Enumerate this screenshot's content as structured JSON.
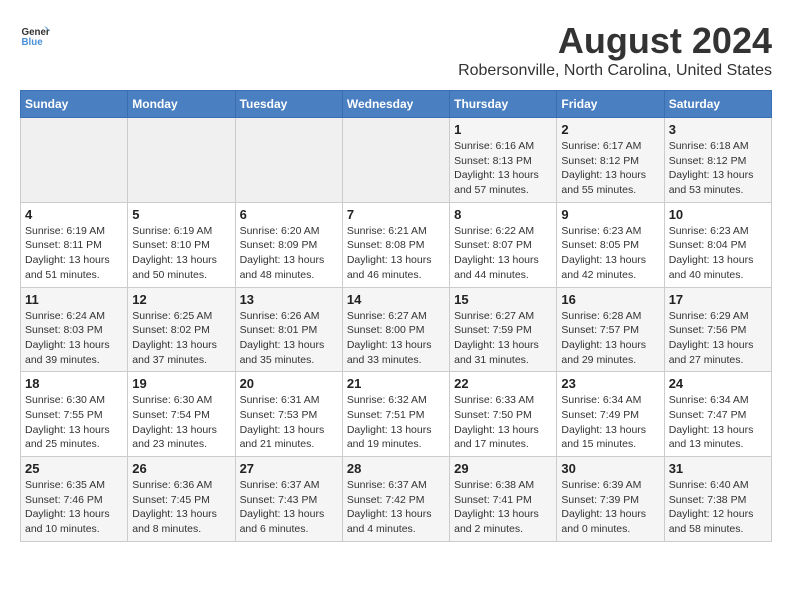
{
  "header": {
    "logo_line1": "General",
    "logo_line2": "Blue",
    "title": "August 2024",
    "subtitle": "Robersonville, North Carolina, United States"
  },
  "weekdays": [
    "Sunday",
    "Monday",
    "Tuesday",
    "Wednesday",
    "Thursday",
    "Friday",
    "Saturday"
  ],
  "weeks": [
    [
      {
        "day": "",
        "info": ""
      },
      {
        "day": "",
        "info": ""
      },
      {
        "day": "",
        "info": ""
      },
      {
        "day": "",
        "info": ""
      },
      {
        "day": "1",
        "info": "Sunrise: 6:16 AM\nSunset: 8:13 PM\nDaylight: 13 hours\nand 57 minutes."
      },
      {
        "day": "2",
        "info": "Sunrise: 6:17 AM\nSunset: 8:12 PM\nDaylight: 13 hours\nand 55 minutes."
      },
      {
        "day": "3",
        "info": "Sunrise: 6:18 AM\nSunset: 8:12 PM\nDaylight: 13 hours\nand 53 minutes."
      }
    ],
    [
      {
        "day": "4",
        "info": "Sunrise: 6:19 AM\nSunset: 8:11 PM\nDaylight: 13 hours\nand 51 minutes."
      },
      {
        "day": "5",
        "info": "Sunrise: 6:19 AM\nSunset: 8:10 PM\nDaylight: 13 hours\nand 50 minutes."
      },
      {
        "day": "6",
        "info": "Sunrise: 6:20 AM\nSunset: 8:09 PM\nDaylight: 13 hours\nand 48 minutes."
      },
      {
        "day": "7",
        "info": "Sunrise: 6:21 AM\nSunset: 8:08 PM\nDaylight: 13 hours\nand 46 minutes."
      },
      {
        "day": "8",
        "info": "Sunrise: 6:22 AM\nSunset: 8:07 PM\nDaylight: 13 hours\nand 44 minutes."
      },
      {
        "day": "9",
        "info": "Sunrise: 6:23 AM\nSunset: 8:05 PM\nDaylight: 13 hours\nand 42 minutes."
      },
      {
        "day": "10",
        "info": "Sunrise: 6:23 AM\nSunset: 8:04 PM\nDaylight: 13 hours\nand 40 minutes."
      }
    ],
    [
      {
        "day": "11",
        "info": "Sunrise: 6:24 AM\nSunset: 8:03 PM\nDaylight: 13 hours\nand 39 minutes."
      },
      {
        "day": "12",
        "info": "Sunrise: 6:25 AM\nSunset: 8:02 PM\nDaylight: 13 hours\nand 37 minutes."
      },
      {
        "day": "13",
        "info": "Sunrise: 6:26 AM\nSunset: 8:01 PM\nDaylight: 13 hours\nand 35 minutes."
      },
      {
        "day": "14",
        "info": "Sunrise: 6:27 AM\nSunset: 8:00 PM\nDaylight: 13 hours\nand 33 minutes."
      },
      {
        "day": "15",
        "info": "Sunrise: 6:27 AM\nSunset: 7:59 PM\nDaylight: 13 hours\nand 31 minutes."
      },
      {
        "day": "16",
        "info": "Sunrise: 6:28 AM\nSunset: 7:57 PM\nDaylight: 13 hours\nand 29 minutes."
      },
      {
        "day": "17",
        "info": "Sunrise: 6:29 AM\nSunset: 7:56 PM\nDaylight: 13 hours\nand 27 minutes."
      }
    ],
    [
      {
        "day": "18",
        "info": "Sunrise: 6:30 AM\nSunset: 7:55 PM\nDaylight: 13 hours\nand 25 minutes."
      },
      {
        "day": "19",
        "info": "Sunrise: 6:30 AM\nSunset: 7:54 PM\nDaylight: 13 hours\nand 23 minutes."
      },
      {
        "day": "20",
        "info": "Sunrise: 6:31 AM\nSunset: 7:53 PM\nDaylight: 13 hours\nand 21 minutes."
      },
      {
        "day": "21",
        "info": "Sunrise: 6:32 AM\nSunset: 7:51 PM\nDaylight: 13 hours\nand 19 minutes."
      },
      {
        "day": "22",
        "info": "Sunrise: 6:33 AM\nSunset: 7:50 PM\nDaylight: 13 hours\nand 17 minutes."
      },
      {
        "day": "23",
        "info": "Sunrise: 6:34 AM\nSunset: 7:49 PM\nDaylight: 13 hours\nand 15 minutes."
      },
      {
        "day": "24",
        "info": "Sunrise: 6:34 AM\nSunset: 7:47 PM\nDaylight: 13 hours\nand 13 minutes."
      }
    ],
    [
      {
        "day": "25",
        "info": "Sunrise: 6:35 AM\nSunset: 7:46 PM\nDaylight: 13 hours\nand 10 minutes."
      },
      {
        "day": "26",
        "info": "Sunrise: 6:36 AM\nSunset: 7:45 PM\nDaylight: 13 hours\nand 8 minutes."
      },
      {
        "day": "27",
        "info": "Sunrise: 6:37 AM\nSunset: 7:43 PM\nDaylight: 13 hours\nand 6 minutes."
      },
      {
        "day": "28",
        "info": "Sunrise: 6:37 AM\nSunset: 7:42 PM\nDaylight: 13 hours\nand 4 minutes."
      },
      {
        "day": "29",
        "info": "Sunrise: 6:38 AM\nSunset: 7:41 PM\nDaylight: 13 hours\nand 2 minutes."
      },
      {
        "day": "30",
        "info": "Sunrise: 6:39 AM\nSunset: 7:39 PM\nDaylight: 13 hours\nand 0 minutes."
      },
      {
        "day": "31",
        "info": "Sunrise: 6:40 AM\nSunset: 7:38 PM\nDaylight: 12 hours\nand 58 minutes."
      }
    ]
  ]
}
